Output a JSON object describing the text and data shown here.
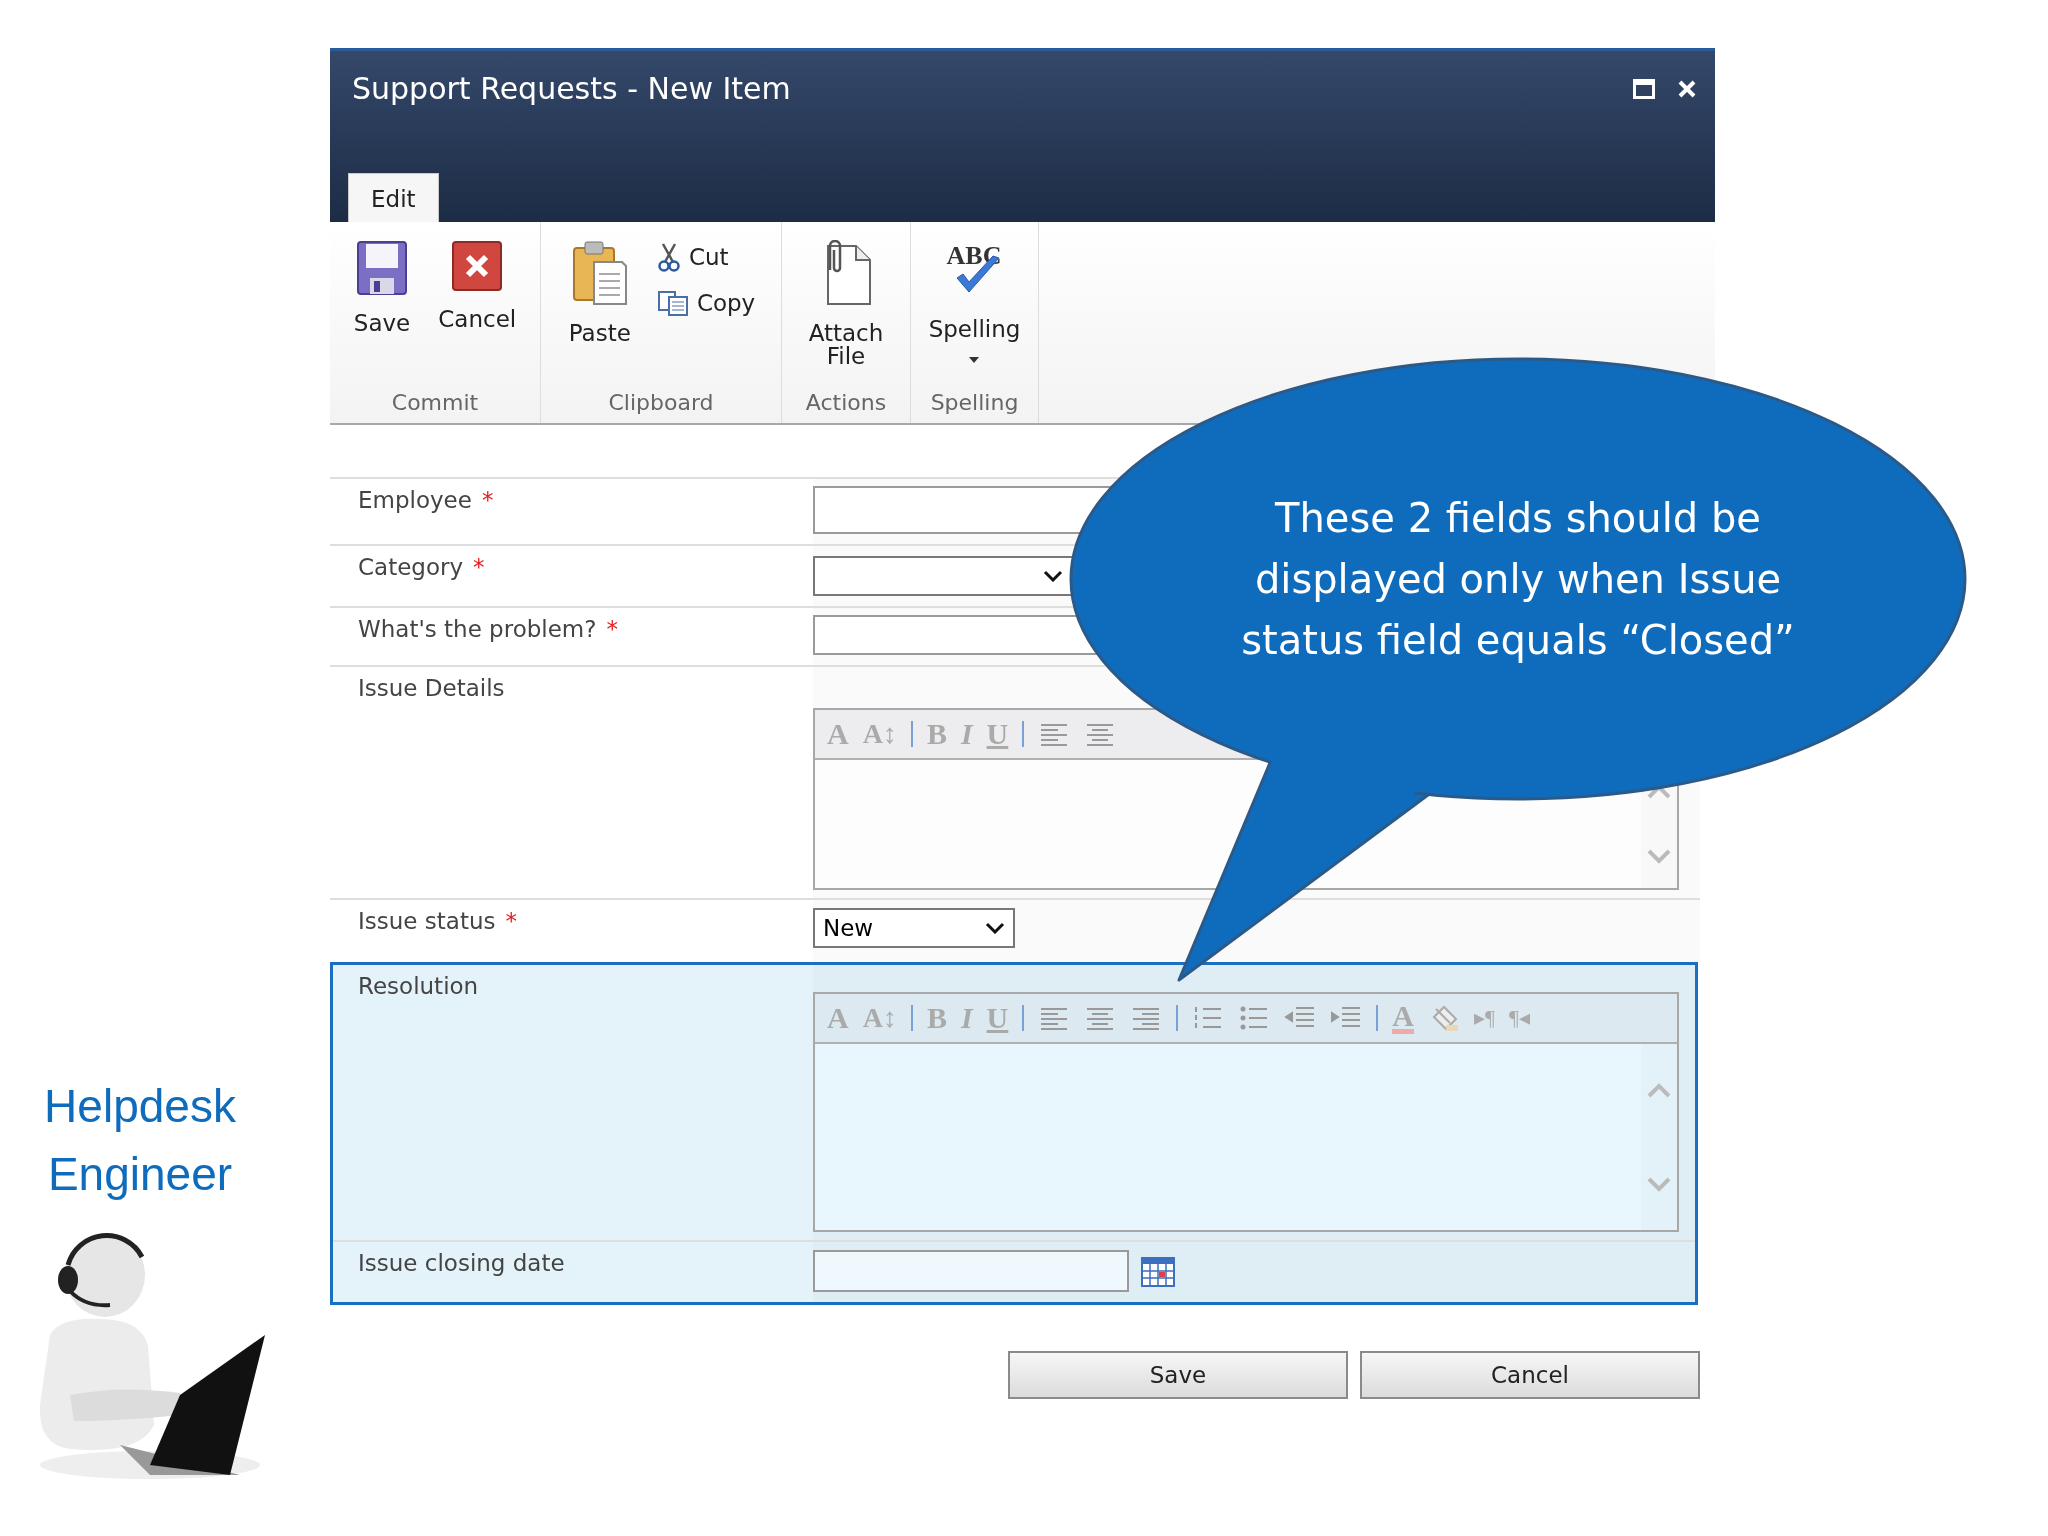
{
  "window": {
    "title": "Support Requests - New Item"
  },
  "ribbon": {
    "tabs": [
      {
        "label": "Edit",
        "selected": true
      }
    ],
    "groups": [
      {
        "label": "Commit",
        "buttons": [
          {
            "label": "Save",
            "kind": "save"
          },
          {
            "label": "Cancel",
            "kind": "cancel"
          }
        ]
      },
      {
        "label": "Clipboard",
        "buttons": [
          {
            "label": "Paste",
            "kind": "paste"
          },
          {
            "label": "Cut",
            "kind": "cut"
          },
          {
            "label": "Copy",
            "kind": "copy"
          }
        ]
      },
      {
        "label": "Actions",
        "buttons": [
          {
            "label": "Attach File",
            "kind": "attach"
          }
        ]
      },
      {
        "label": "Spelling",
        "buttons": [
          {
            "label": "Spelling",
            "kind": "spelling",
            "icon_text": "ABC",
            "dropdown": true
          }
        ]
      }
    ]
  },
  "form": {
    "fields": [
      {
        "label": "Employee",
        "required_mark": "*",
        "kind": "text",
        "highlighted": false
      },
      {
        "label": "Category",
        "required_mark": "*",
        "kind": "select",
        "highlighted": false
      },
      {
        "label": "What's the problem?",
        "required_mark": "*",
        "kind": "text",
        "highlighted": false
      },
      {
        "label": "Issue Details",
        "kind": "richtext",
        "highlighted": false,
        "tools": [
          {
            "kind": "font",
            "text": "A"
          },
          {
            "kind": "size",
            "text": "A↕"
          },
          {
            "kind": "separator"
          },
          {
            "kind": "bold",
            "text": "B"
          },
          {
            "kind": "italic",
            "text": "I"
          },
          {
            "kind": "underline",
            "text": "U"
          },
          {
            "kind": "separator"
          },
          {
            "kind": "align-left"
          },
          {
            "kind": "align-center"
          }
        ]
      },
      {
        "label": "Issue status",
        "required_mark": "*",
        "kind": "select",
        "value": "New",
        "highlighted": false
      },
      {
        "label": "Resolution",
        "kind": "richtext",
        "highlighted": true,
        "tools": [
          {
            "kind": "font",
            "text": "A"
          },
          {
            "kind": "size",
            "text": "A↕"
          },
          {
            "kind": "separator"
          },
          {
            "kind": "bold",
            "text": "B"
          },
          {
            "kind": "italic",
            "text": "I"
          },
          {
            "kind": "underline",
            "text": "U"
          },
          {
            "kind": "separator"
          },
          {
            "kind": "align-left"
          },
          {
            "kind": "align-center"
          },
          {
            "kind": "align-right"
          },
          {
            "kind": "separator"
          },
          {
            "kind": "numbered-list"
          },
          {
            "kind": "bulleted-list"
          },
          {
            "kind": "outdent"
          },
          {
            "kind": "indent"
          },
          {
            "kind": "separator"
          },
          {
            "kind": "font-color",
            "text": "A"
          },
          {
            "kind": "highlight"
          },
          {
            "kind": "ltr",
            "text": "▸¶"
          },
          {
            "kind": "rtl",
            "text": "¶◂"
          }
        ]
      },
      {
        "label": "Issue closing date",
        "kind": "date",
        "highlighted": true
      }
    ],
    "buttons": [
      "Save",
      "Cancel"
    ]
  },
  "callout": {
    "text": "These 2 fields should be displayed only when Issue status field equals “Closed”"
  },
  "persona": {
    "title": "Helpdesk Engineer"
  }
}
